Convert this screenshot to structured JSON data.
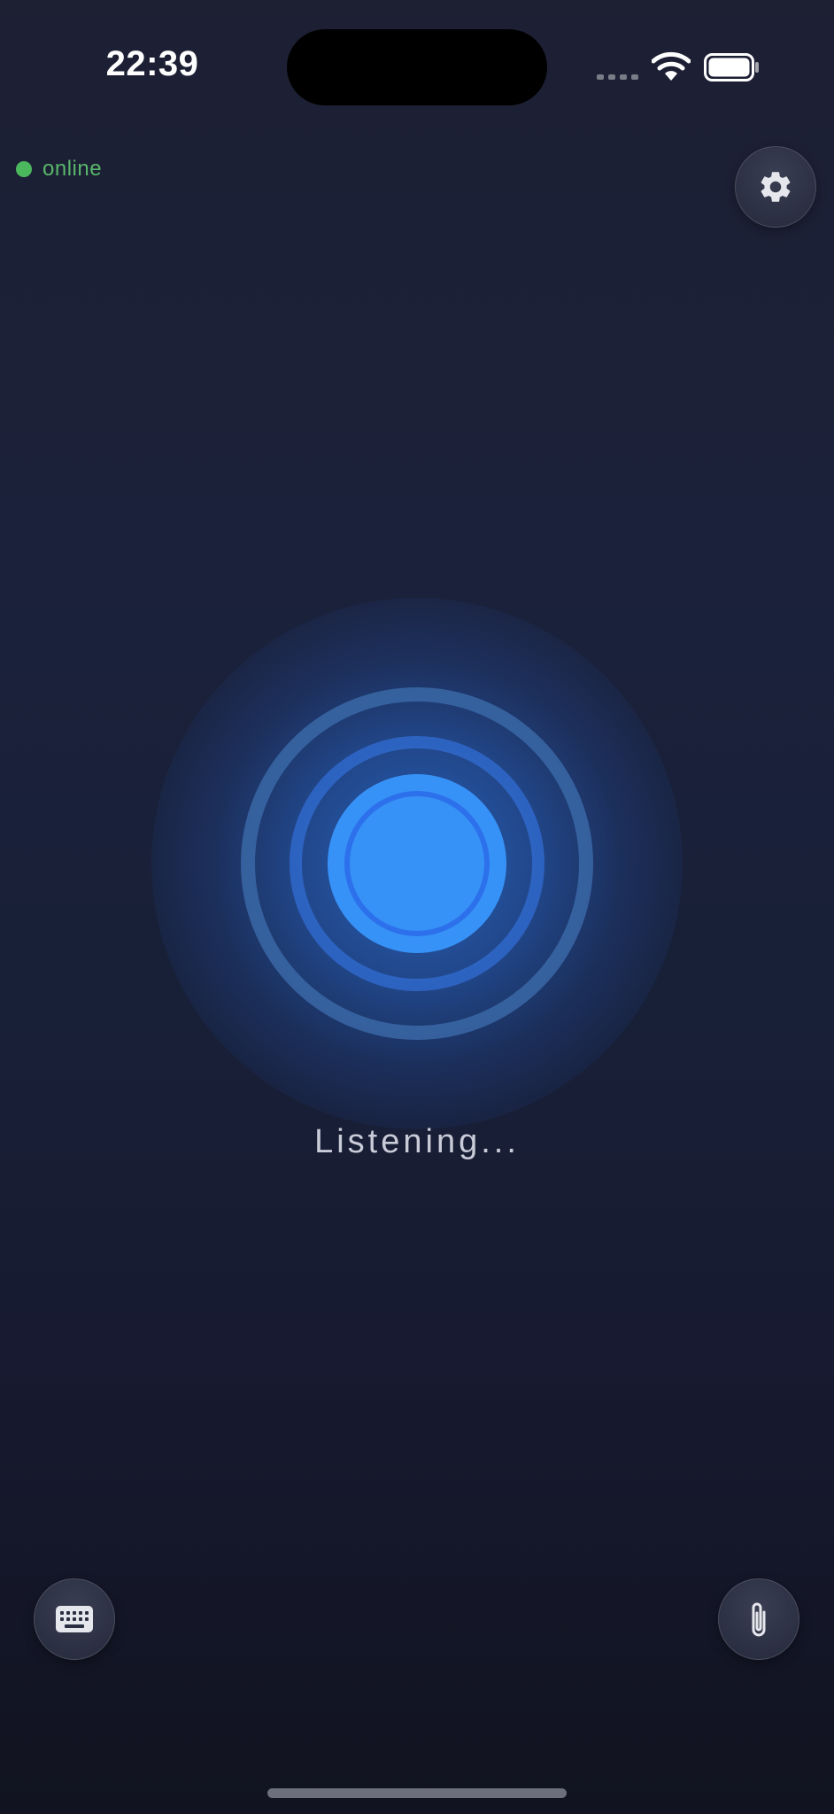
{
  "status_bar": {
    "time": "22:39",
    "icons": [
      "cellular-signal-icon",
      "wifi-icon",
      "battery-icon"
    ]
  },
  "connection": {
    "status_label": "online",
    "status_color": "#4cb85e"
  },
  "toolbar": {
    "settings_icon": "gear-icon",
    "keyboard_icon": "keyboard-icon",
    "attach_icon": "paperclip-icon"
  },
  "voice": {
    "state_label": "Listening...",
    "orb_color": "#3792f7",
    "ring_color": "#2f6fcc"
  }
}
